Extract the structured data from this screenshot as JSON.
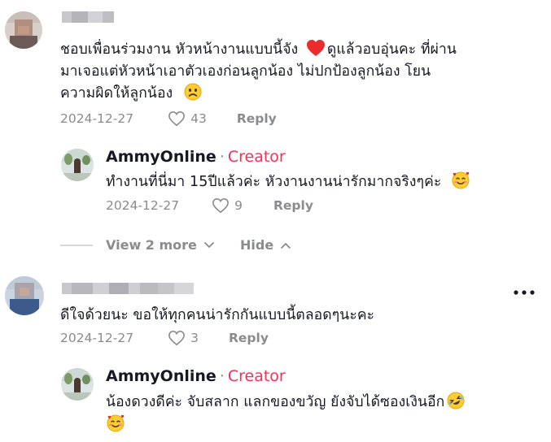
{
  "colors": {
    "creator": "#fe2c55",
    "muted": "#8a8b91",
    "text": "#161823",
    "heart": "#f23a3a",
    "emoji_yellow": "#ffcc33"
  },
  "comments": [
    {
      "text_line1": "ชอบเพื่อนร่วมงาน หัวหน้างานแบบนี้จัง",
      "text_line1b": "ดูแล้วอบอุ่นคะ ที่ผ่าน",
      "text_line2": "มาเจอแต่หัวหน้าเอาตัวเองก่อนลูกน้อง ไม่ปกป้องลูกน้อง โยน",
      "text_line3": "ความผิดให้ลูกน้อง",
      "date": "2024-12-27",
      "likes": "43",
      "reply_label": "Reply",
      "emojis": [
        "red-heart",
        "sad-face"
      ],
      "reply": {
        "username": "AmmyOnline",
        "separator": "·",
        "badge": "Creator",
        "text": "ทำงานที่นี่มา 15ปีแล้วค่ะ หัวงานงานน่ารักมากจริงๆค่ะ",
        "date": "2024-12-27",
        "likes": "9",
        "reply_label": "Reply",
        "emoji": "smiling-face-with-hearts"
      },
      "view_more_label": "View 2 more",
      "hide_label": "Hide"
    },
    {
      "text": "ดีใจด้วยนะ ขอให้ทุกคนน่ารักกันแบบนี้ตลอดๆนะคะ",
      "date": "2024-12-27",
      "likes": "3",
      "reply_label": "Reply",
      "more_icon": "more-dots-icon",
      "reply": {
        "username": "AmmyOnline",
        "separator": "·",
        "badge": "Creator",
        "text": "น้องดวงดีค่ะ จับสลาก แลกของขวัญ ยังจับได้ซองเงินอีก",
        "emojis": [
          "rolling-on-floor-laughing",
          "smiling-face-with-hearts"
        ]
      }
    }
  ]
}
